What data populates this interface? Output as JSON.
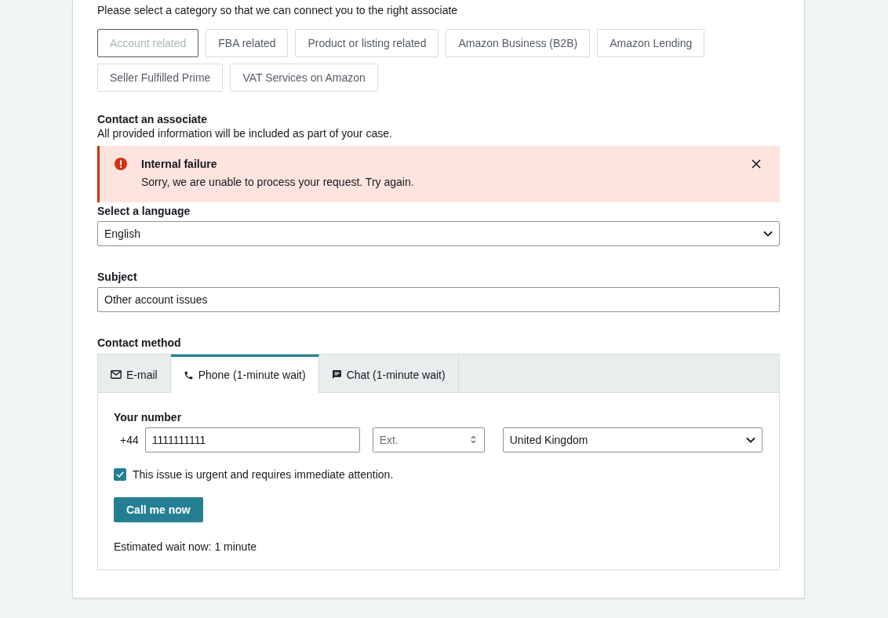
{
  "intro": "Please select a category so that we can connect you to the right associate",
  "categories": [
    {
      "label": "Account related",
      "selected": true
    },
    {
      "label": "FBA related",
      "selected": false
    },
    {
      "label": "Product or listing related",
      "selected": false
    },
    {
      "label": "Amazon Business (B2B)",
      "selected": false
    },
    {
      "label": "Amazon Lending",
      "selected": false
    },
    {
      "label": "Seller Fulfilled Prime",
      "selected": false
    },
    {
      "label": "VAT Services on Amazon",
      "selected": false
    }
  ],
  "contact": {
    "title": "Contact an associate",
    "description": "All provided information will be included as part of your case."
  },
  "alert": {
    "title": "Internal failure",
    "message": "Sorry, we are unable to process your request. Try again."
  },
  "language": {
    "label": "Select a language",
    "value": "English"
  },
  "subject": {
    "label": "Subject",
    "value": "Other account issues"
  },
  "contact_method": {
    "label": "Contact method",
    "tabs": [
      {
        "kind": "email",
        "label": "E-mail",
        "selected": false
      },
      {
        "kind": "phone",
        "label": "Phone (1-minute wait)",
        "selected": true
      },
      {
        "kind": "chat",
        "label": "Chat (1-minute wait)",
        "selected": false
      }
    ]
  },
  "phone": {
    "label": "Your number",
    "prefix": "+44",
    "number": "1111111111",
    "extension_placeholder": "Ext.",
    "country": "United Kingdom",
    "urgent": {
      "label": "This issue is urgent and requires immediate attention.",
      "checked": true
    },
    "button": "Call me now",
    "wait": "Estimated wait now: 1 minute"
  }
}
